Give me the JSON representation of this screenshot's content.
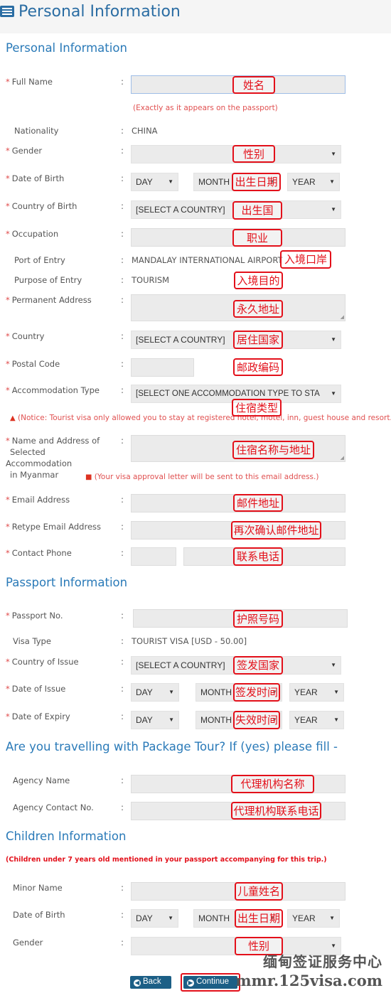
{
  "header": {
    "title": "Personal Information",
    "icon": "list-icon"
  },
  "personal": {
    "title": "Personal Information",
    "full_name": "Full Name",
    "full_name_hint": "(Exactly as it appears on the passport)",
    "nationality": "Nationality",
    "nationality_value": "CHINA",
    "gender": "Gender",
    "dob": "Date of Birth",
    "day": "DAY",
    "month": "MONTH",
    "year": "YEAR",
    "country_of_birth": "Country of Birth",
    "select_country": "[SELECT A COUNTRY]",
    "occupation": "Occupation",
    "port_of_entry": "Port of Entry",
    "port_value": "MANDALAY INTERNATIONAL AIRPORT",
    "purpose": "Purpose of Entry",
    "purpose_value": "TOURISM",
    "permanent_address": "Permanent Address",
    "country": "Country",
    "postal_code": "Postal Code",
    "accommodation_type": "Accommodation Type",
    "accommodation_select": "[SELECT ONE ACCOMMODATION TYPE TO STA",
    "notice": "(Notice: Tourist visa only allowed you to stay at registered hotel, motel, inn, guest house and resort.)",
    "accom_name_1": "Name and Address of",
    "accom_name_2": "Selected Accommodation",
    "accom_name_3": "in Myanmar",
    "email_hint": "(Your visa approval letter will be sent to this email address.)",
    "email": "Email Address",
    "retype_email": "Retype Email Address",
    "phone": "Contact Phone"
  },
  "passport": {
    "title": "Passport Information",
    "passport_no": "Passport No.",
    "visa_type": "Visa Type",
    "visa_value": "TOURIST VISA [USD - 50.00]",
    "country_of_issue": "Country of Issue",
    "date_of_issue": "Date of Issue",
    "date_of_expiry": "Date of Expiry"
  },
  "tour": {
    "title": "Are you travelling with Package Tour? If (yes) please fill -",
    "agency_name": "Agency Name",
    "agency_contact": "Agency Contact No."
  },
  "children": {
    "title": "Children Information",
    "note": "(Children under 7 years old mentioned in your passport accompanying for this trip.)",
    "minor_name": "Minor Name",
    "dob": "Date of Birth",
    "gender": "Gender"
  },
  "buttons": {
    "back": "Back",
    "continue": "Continue"
  },
  "annotations": {
    "full_name": "姓名",
    "gender": "性别",
    "dob": "出生日期",
    "birth_country": "出生国",
    "occupation": "职业",
    "port": "入境口岸",
    "purpose": "入境目的",
    "perm_address": "永久地址",
    "country": "居住国家",
    "postal": "邮政编码",
    "accom_type": "住宿类型",
    "accom_name": "住宿名称与地址",
    "email": "邮件地址",
    "retype_email": "再次确认邮件地址",
    "phone": "联系电话",
    "passport_no": "护照号码",
    "issue_country": "签发国家",
    "issue_date": "签发时间",
    "expiry_date": "失效时间",
    "agency_name": "代理机构名称",
    "agency_contact": "代理机构联系电话",
    "minor_name": "儿童姓名",
    "minor_dob": "出生日期",
    "minor_gender": "性别"
  },
  "watermark": {
    "line1": "缅甸签证服务中心",
    "line2": "mmr.125visa.com"
  },
  "colors": {
    "accent": "#2a7ab8",
    "required": "#e04a4a",
    "annotation": "#e3101a",
    "button": "#1c5f86"
  }
}
